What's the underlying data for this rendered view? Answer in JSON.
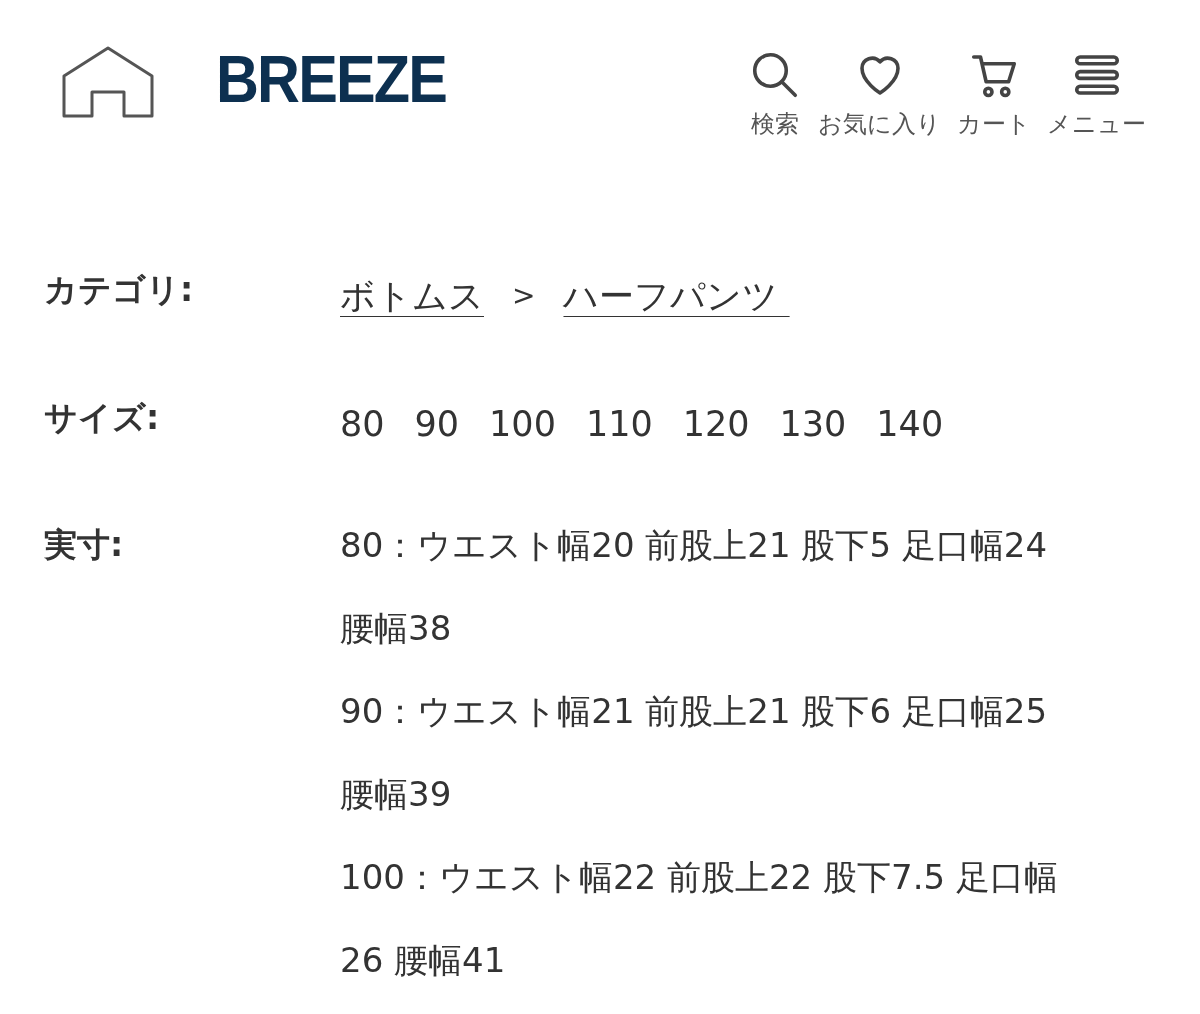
{
  "header": {
    "logo": "BREEZE",
    "actions": [
      {
        "kind": "search",
        "label": "検索"
      },
      {
        "kind": "heart",
        "label": "お気に入り"
      },
      {
        "kind": "cart",
        "label": "カート"
      },
      {
        "kind": "menu",
        "label": "メニュー"
      }
    ]
  },
  "details": [
    {
      "kind": "links",
      "label": "カテゴリ:",
      "links": [
        "ボトムス",
        "ハーフパンツ "
      ],
      "separator": ">"
    },
    {
      "kind": "sizes",
      "label": "サイズ:",
      "sizes": [
        "80",
        "90",
        "100",
        "110",
        "120",
        "130",
        "140"
      ]
    },
    {
      "kind": "measurements",
      "label": "実寸:",
      "entries": [
        {
          "lines": [
            "80：ウエスト幅20 前股上21 股下5 足口幅24",
            "腰幅38"
          ]
        },
        {
          "lines": [
            "90：ウエスト幅21 前股上21 股下6 足口幅25",
            "腰幅39"
          ]
        },
        {
          "lines": [
            "100：ウエスト幅22 前股上22 股下7.5 足口幅",
            "26 腰幅41"
          ]
        }
      ]
    }
  ]
}
